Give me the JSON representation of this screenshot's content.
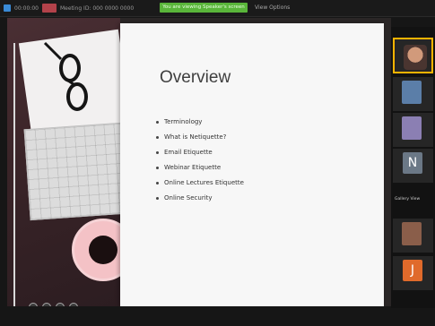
{
  "topbar": {
    "left_text": "00:00:00",
    "meeting_text": "Meeting ID: 000 0000 0000",
    "recording_text": "You are viewing Speaker's screen",
    "right_text": "View Options"
  },
  "slide": {
    "title": "Overview",
    "bullets": [
      "Terminology",
      "What is Netiquette?",
      "Email Etiquette",
      "Webinar Etiquette",
      "Online Lectures Etiquette",
      "Online Security"
    ]
  },
  "participants": {
    "tiles": [
      {
        "label": "",
        "initial": "",
        "color": "#3a4a62"
      },
      {
        "label": "",
        "initial": "",
        "color": "#5b7ea8"
      },
      {
        "label": "",
        "initial": "",
        "color": "#8b7fb3"
      },
      {
        "label": "",
        "initial": "N",
        "color": "#6b7886"
      },
      {
        "label": "",
        "initial": "",
        "color": "#8a5e4a"
      },
      {
        "label": "",
        "initial": "J",
        "color": "#e06a2b"
      }
    ],
    "mid_label": "Gallery View"
  },
  "colors": {
    "active_speaker_border": "#ffb400",
    "recording_green": "#59b53a"
  }
}
